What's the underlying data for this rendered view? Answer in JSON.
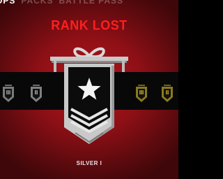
{
  "nav": {
    "tabs": [
      {
        "label": "OPS",
        "active": true
      },
      {
        "label": "PACKS",
        "active": false
      },
      {
        "label": "BATTLE PASS",
        "active": false
      }
    ]
  },
  "result": {
    "headline": "RANK LOST",
    "rank_name": "SILVER I"
  },
  "colors": {
    "background": "#8e1016",
    "headline": "#ff1f1f",
    "silver": "#c8c8c8",
    "bronze": "#8a7a1c",
    "band": "#080808"
  },
  "badges": [
    {
      "rank": "bronze",
      "icon": "rank-badge-icon"
    },
    {
      "rank": "bronze",
      "icon": "rank-badge-icon"
    },
    {
      "rank": "silver",
      "icon": "rank-badge-icon",
      "current": true
    },
    {
      "rank": "gold",
      "icon": "rank-badge-icon"
    },
    {
      "rank": "gold",
      "icon": "rank-badge-icon"
    }
  ]
}
